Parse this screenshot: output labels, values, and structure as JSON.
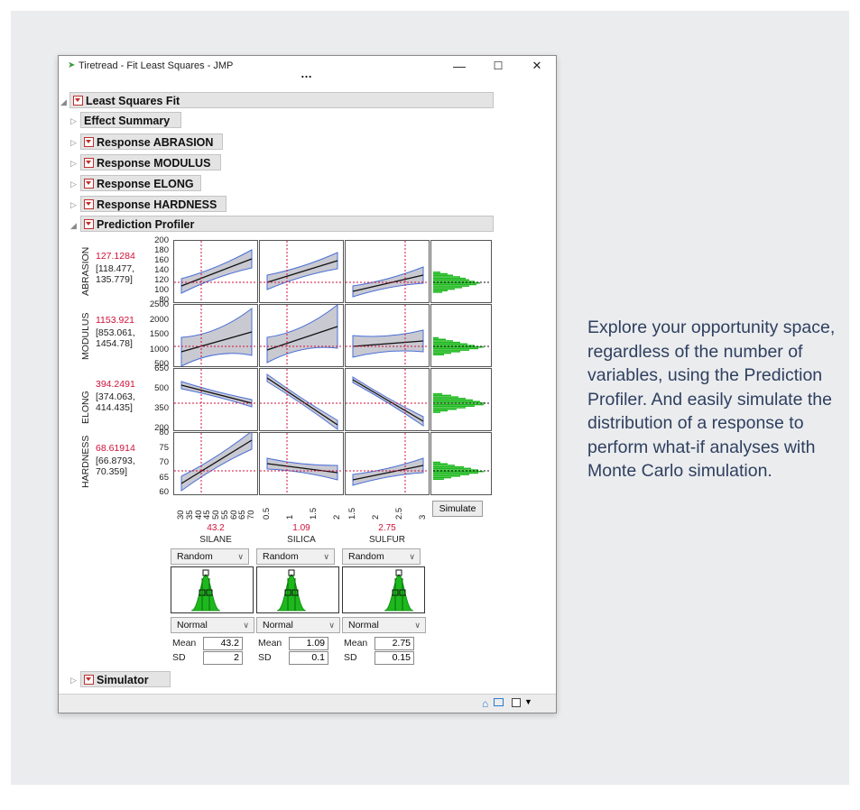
{
  "window": {
    "title": "Tiretread - Fit Least Squares - JMP",
    "more": "…",
    "controls": {
      "minimize": "—",
      "maximize": "☐",
      "close": "✕"
    }
  },
  "report": {
    "top": "Least Squares Fit",
    "sections": [
      {
        "label": "Effect Summary"
      },
      {
        "label": "Response ABRASION"
      },
      {
        "label": "Response MODULUS"
      },
      {
        "label": "Response ELONG"
      },
      {
        "label": "Response HARDNESS"
      }
    ],
    "profiler": "Prediction Profiler",
    "simulator": "Simulator"
  },
  "profiler": {
    "responses": [
      {
        "name": "ABRASION",
        "value": "127.1284",
        "ci": [
          "[118.477,",
          "135.779]"
        ],
        "ticks": [
          "200",
          "180",
          "160",
          "140",
          "120",
          "100",
          "80"
        ]
      },
      {
        "name": "MODULUS",
        "value": "1153.921",
        "ci": [
          "[853.061,",
          "1454.78]"
        ],
        "ticks": [
          "2500",
          "2000",
          "1500",
          "1000",
          "500"
        ]
      },
      {
        "name": "ELONG",
        "value": "394.2491",
        "ci": [
          "[374.063,",
          "414.435]"
        ],
        "ticks": [
          "650",
          "500",
          "350",
          "200"
        ]
      },
      {
        "name": "HARDNESS",
        "value": "68.61914",
        "ci": [
          "[66.8793,",
          "70.359]"
        ],
        "ticks": [
          "80",
          "75",
          "70",
          "65",
          "60"
        ]
      }
    ],
    "factors": [
      {
        "name": "SILANE",
        "value": "43.2",
        "ticks": [
          "30",
          "35",
          "40",
          "45",
          "50",
          "55",
          "60",
          "65",
          "70"
        ],
        "random": "Random",
        "dist": "Normal",
        "mean_label": "Mean",
        "mean": "43.2",
        "sd_label": "SD",
        "sd": "2"
      },
      {
        "name": "SILICA",
        "value": "1.09",
        "ticks": [
          "0.5",
          "1",
          "1.5",
          "2"
        ],
        "random": "Random",
        "dist": "Normal",
        "mean_label": "Mean",
        "mean": "1.09",
        "sd_label": "SD",
        "sd": "0.1"
      },
      {
        "name": "SULFUR",
        "value": "2.75",
        "ticks": [
          "1.5",
          "2",
          "2.5",
          "3"
        ],
        "random": "Random",
        "dist": "Normal",
        "mean_label": "Mean",
        "mean": "2.75",
        "sd_label": "SD",
        "sd": "0.15"
      }
    ],
    "simulate_button": "Simulate"
  },
  "caption": "Explore your opportunity space, regardless of the number of variables, using the Prediction Profiler. And easily simulate the distribution of a response to perform what-if analyses with Monte Carlo simulation.",
  "colors": {
    "current": "#d0103a",
    "histogram": "#1db81d",
    "band": "#c9c9d2",
    "band_edge": "#4a6fd6"
  }
}
